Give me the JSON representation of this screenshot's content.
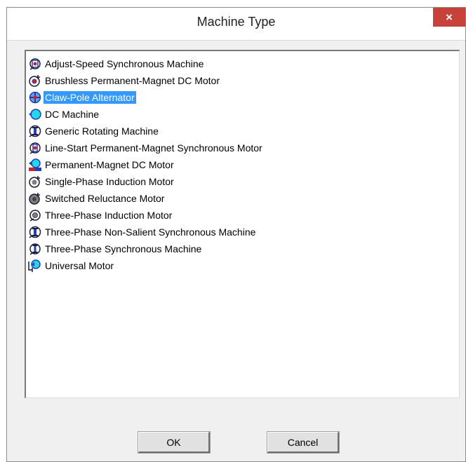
{
  "window": {
    "title": "Machine Type",
    "close_label": "×"
  },
  "list": {
    "selected_index": 2,
    "items": [
      {
        "label": "Adjust-Speed  Synchronous Machine",
        "icon": "adjust-speed-synchronous-icon"
      },
      {
        "label": "Brushless Permanent-Magnet DC Motor",
        "icon": "brushless-pm-dc-motor-icon"
      },
      {
        "label": "Claw-Pole Alternator",
        "icon": "claw-pole-alternator-icon"
      },
      {
        "label": "DC Machine",
        "icon": "dc-machine-icon"
      },
      {
        "label": "Generic Rotating Machine",
        "icon": "generic-rotating-machine-icon"
      },
      {
        "label": "Line-Start Permanent-Magnet Synchronous Motor",
        "icon": "line-start-pm-synchronous-icon"
      },
      {
        "label": "Permanent-Magnet DC Motor",
        "icon": "pm-dc-motor-icon"
      },
      {
        "label": "Single-Phase Induction Motor",
        "icon": "single-phase-induction-icon"
      },
      {
        "label": "Switched Reluctance Motor",
        "icon": "switched-reluctance-icon"
      },
      {
        "label": "Three-Phase Induction Motor",
        "icon": "three-phase-induction-icon"
      },
      {
        "label": "Three-Phase Non-Salient Synchronous Machine",
        "icon": "three-phase-non-salient-icon"
      },
      {
        "label": "Three-Phase Synchronous Machine",
        "icon": "three-phase-synchronous-icon"
      },
      {
        "label": "Universal Motor",
        "icon": "universal-motor-icon"
      }
    ]
  },
  "buttons": {
    "ok_label": "OK",
    "cancel_label": "Cancel"
  },
  "colors": {
    "selection": "#3399ff",
    "close_button": "#c7423a"
  }
}
